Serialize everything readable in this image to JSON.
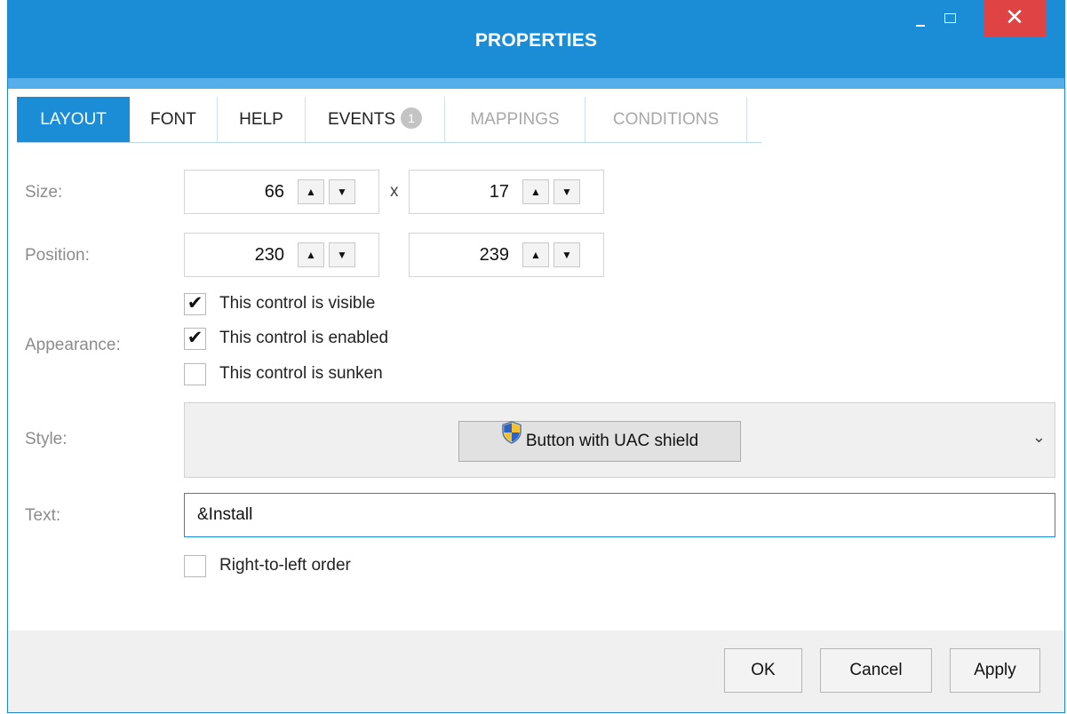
{
  "window": {
    "title": "PROPERTIES",
    "close_glyph": "✕",
    "accent_color": "#1a8dd6",
    "close_color": "#e04343"
  },
  "tabs": [
    {
      "label": "LAYOUT",
      "active": true
    },
    {
      "label": "FONT"
    },
    {
      "label": "HELP"
    },
    {
      "label": "EVENTS",
      "badge": "1"
    },
    {
      "label": "MAPPINGS",
      "disabled": true
    },
    {
      "label": "CONDITIONS",
      "disabled": true
    }
  ],
  "form": {
    "size_label": "Size:",
    "size_width": "66",
    "size_separator": "x",
    "size_height": "17",
    "position_label": "Position:",
    "position_x": "230",
    "position_y": "239",
    "appearance_label": "Appearance:",
    "visible_label": "This control is visible",
    "visible_checked": true,
    "enabled_label": "This control is enabled",
    "enabled_checked": true,
    "sunken_label": "This control is sunken",
    "sunken_checked": false,
    "style_label": "Style:",
    "style_value": "Button with UAC shield",
    "text_label": "Text:",
    "text_value": "&Install",
    "rtl_label": "Right-to-left order",
    "rtl_checked": false
  },
  "icons": {
    "spin_up": "▲",
    "spin_down": "▼",
    "check": "✔",
    "chevron": "⌄"
  },
  "footer": {
    "ok_label": "OK",
    "cancel_label": "Cancel",
    "apply_label": "Apply"
  }
}
